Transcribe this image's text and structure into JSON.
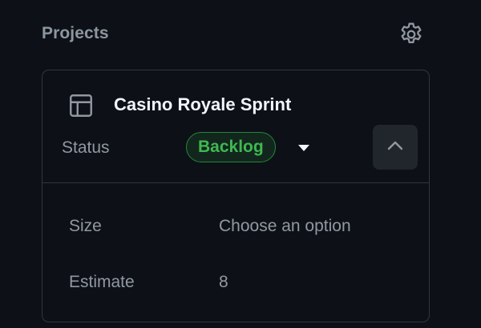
{
  "section": {
    "title": "Projects",
    "settings_icon": "gear-icon"
  },
  "project": {
    "icon": "table-icon",
    "name": "Casino Royale Sprint",
    "status_label": "Status",
    "status_value": "Backlog",
    "status_dropdown_icon": "caret-down-icon",
    "collapse_icon": "chevron-up-icon"
  },
  "fields": [
    {
      "label": "Size",
      "value": "Choose an option"
    },
    {
      "label": "Estimate",
      "value": "8"
    }
  ],
  "colors": {
    "background": "#0d1117",
    "border": "#30363d",
    "muted_text": "#9198a1",
    "status_green": "#3fb950",
    "status_badge_bg": "#12261e",
    "status_badge_border": "#238636",
    "button_bg": "#21262d"
  }
}
